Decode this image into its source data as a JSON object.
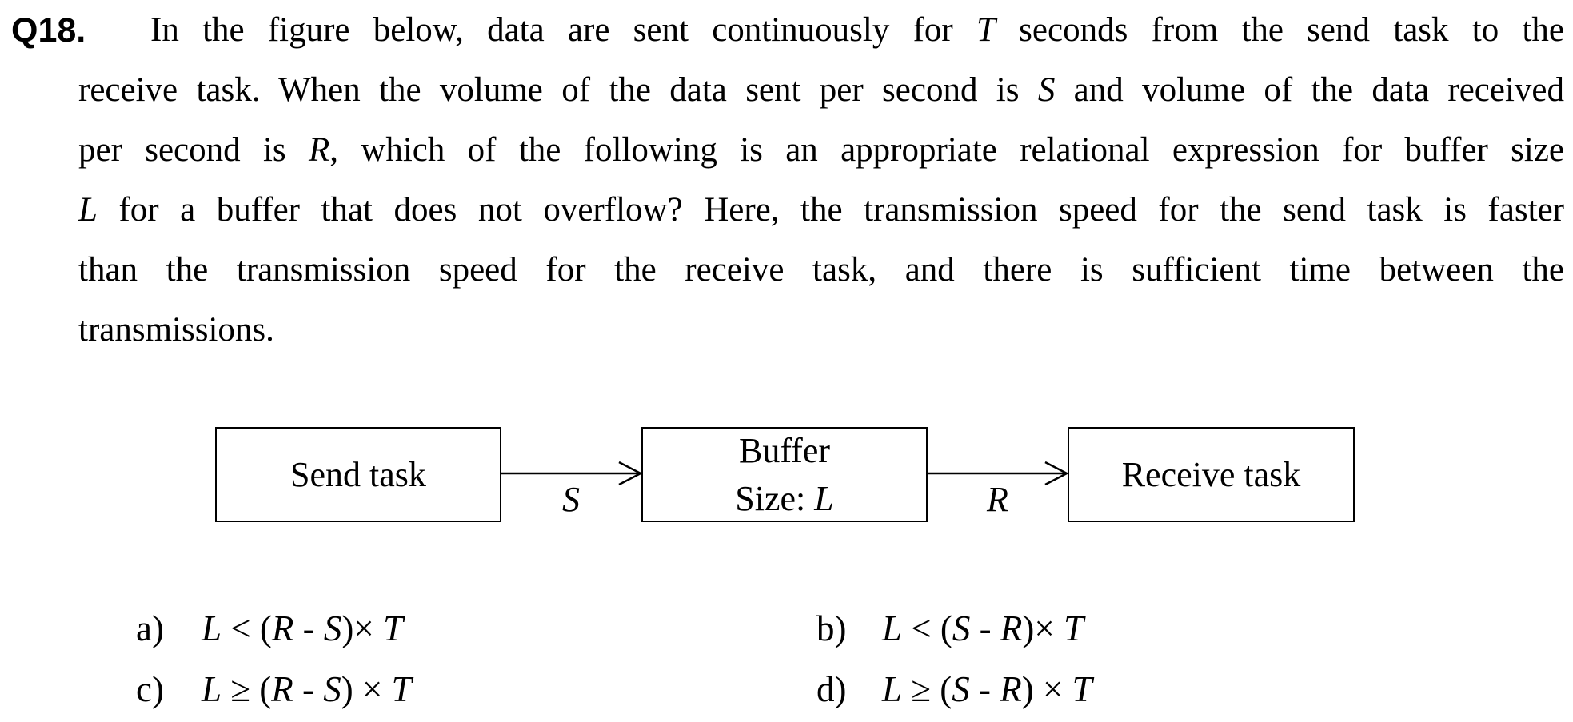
{
  "question": {
    "number": "Q18.",
    "stem_lines": [
      [
        "In the figure below, data are sent continuously for ",
        {
          "i": "T"
        },
        " seconds from the send task to the"
      ],
      [
        "receive task. When the volume of the data sent per second is ",
        {
          "i": "S"
        },
        " and volume of the data received"
      ],
      [
        "per second is ",
        {
          "i": "R"
        },
        ", which of the following is an appropriate relational expression for buffer size"
      ],
      [
        {
          "i": "L"
        },
        " for a buffer that does not overflow? Here, the transmission speed for the send task is faster"
      ],
      [
        "than the transmission speed for the receive task, and there is sufficient time between the"
      ],
      [
        "transmissions."
      ]
    ]
  },
  "diagram": {
    "send_task": "Send task",
    "buffer_line1": "Buffer",
    "buffer_line2_prefix": "Size: ",
    "buffer_line2_var": "L",
    "receive_task": "Receive task",
    "arrow1_label": "S",
    "arrow2_label": "R"
  },
  "choices": [
    {
      "letter": "a)",
      "expr": [
        {
          "i": "L"
        },
        " < (",
        {
          "i": "R"
        },
        " - ",
        {
          "i": "S"
        },
        ")× ",
        {
          "i": "T"
        }
      ]
    },
    {
      "letter": "b)",
      "expr": [
        {
          "i": "L"
        },
        " < (",
        {
          "i": "S"
        },
        " - ",
        {
          "i": "R"
        },
        ")× ",
        {
          "i": "T"
        }
      ]
    },
    {
      "letter": "c)",
      "expr": [
        {
          "i": "L"
        },
        " ≥ (",
        {
          "i": "R"
        },
        " - ",
        {
          "i": "S"
        },
        ") × ",
        {
          "i": "T"
        }
      ]
    },
    {
      "letter": "d)",
      "expr": [
        {
          "i": "L"
        },
        " ≥ (",
        {
          "i": "S"
        },
        " - ",
        {
          "i": "R"
        },
        ") × ",
        {
          "i": "T"
        }
      ]
    }
  ]
}
